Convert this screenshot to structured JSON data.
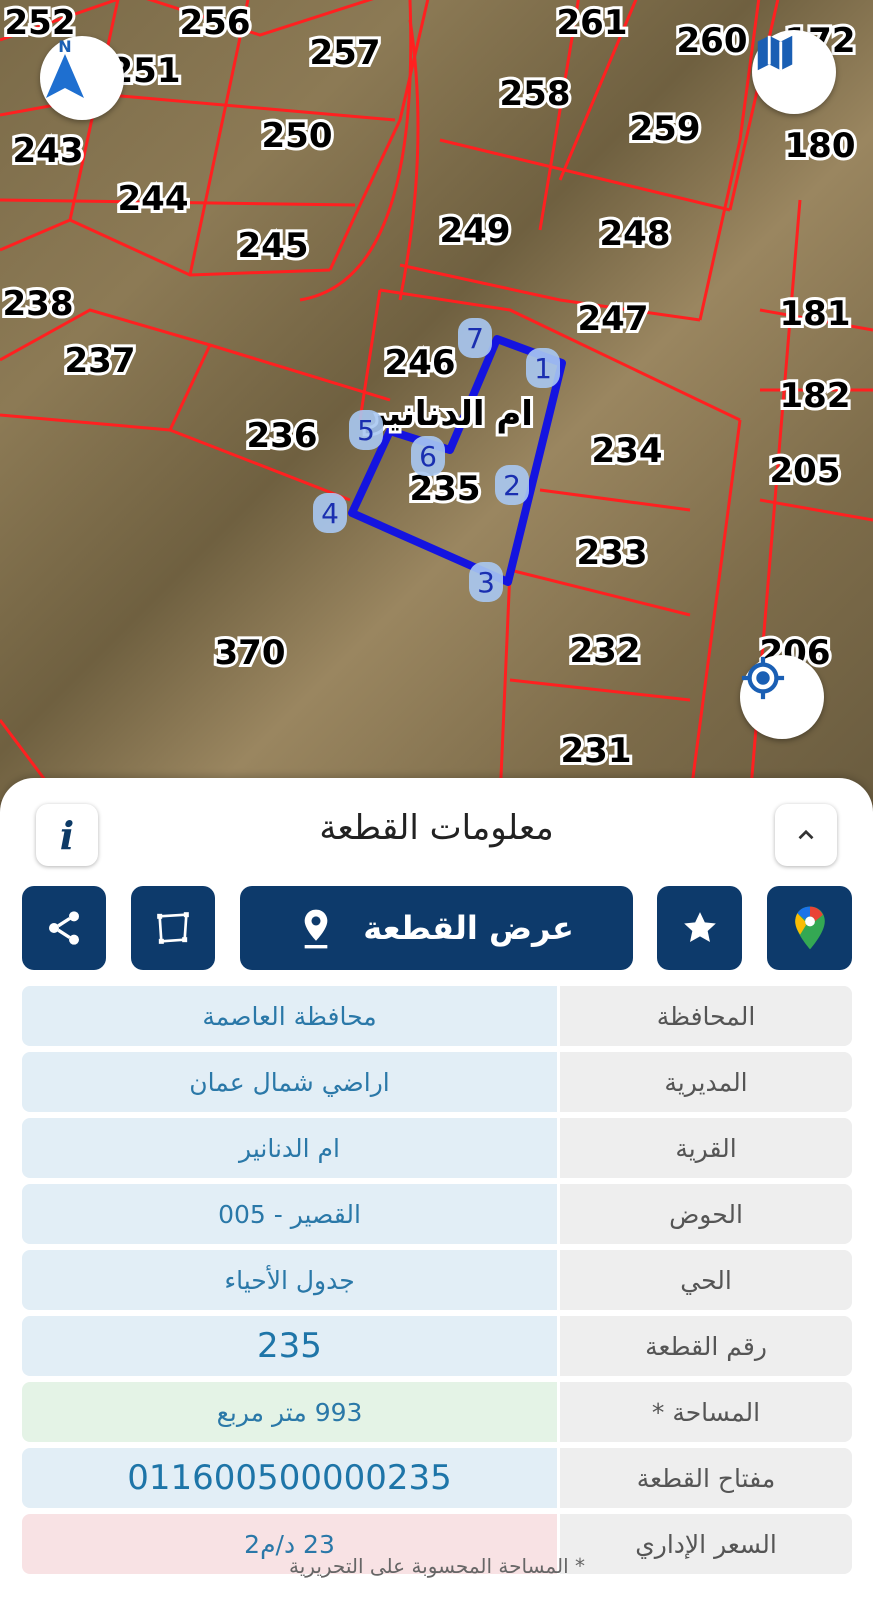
{
  "map": {
    "compass_label": "N",
    "plot_numbers": [
      "252",
      "256",
      "257",
      "261",
      "260",
      "172",
      "251",
      "258",
      "259",
      "243",
      "250",
      "180",
      "244",
      "245",
      "249",
      "248",
      "238",
      "181",
      "237",
      "246",
      "247",
      "182",
      "236",
      "234",
      "205",
      "235",
      "233",
      "370",
      "232",
      "231",
      "206"
    ],
    "village_label": "ام الدنانير",
    "vertex_labels": [
      "1",
      "2",
      "3",
      "4",
      "5",
      "6",
      "7"
    ],
    "boundary_color": "#ff2020",
    "selection_color": "#1414e0"
  },
  "panel": {
    "title": "معلومات القطعة",
    "show_plot_label": "عرض القطعة",
    "rows": [
      {
        "label": "المحافظة",
        "value": "محافظة العاصمة"
      },
      {
        "label": "المديرية",
        "value": "اراضي شمال عمان"
      },
      {
        "label": "القرية",
        "value": "ام الدنانير"
      },
      {
        "label": "الحوض",
        "value": "القصير - 005"
      },
      {
        "label": "الحي",
        "value": "جدول الأحياء"
      },
      {
        "label": "رقم القطعة",
        "value": "235"
      },
      {
        "label": "المساحة *",
        "value": "993  متر مربع"
      },
      {
        "label": "مفتاح القطعة",
        "value": "011600500000235"
      },
      {
        "label": "السعر الإداري",
        "value": "23 د/م2"
      }
    ],
    "footnote": "* المساحة المحسوبة على التحريرية"
  },
  "colors": {
    "primary": "#0d3a6b",
    "value_text": "#2a78a8",
    "area_bg": "#e4f3e6",
    "price_bg": "#f8e2e4"
  }
}
